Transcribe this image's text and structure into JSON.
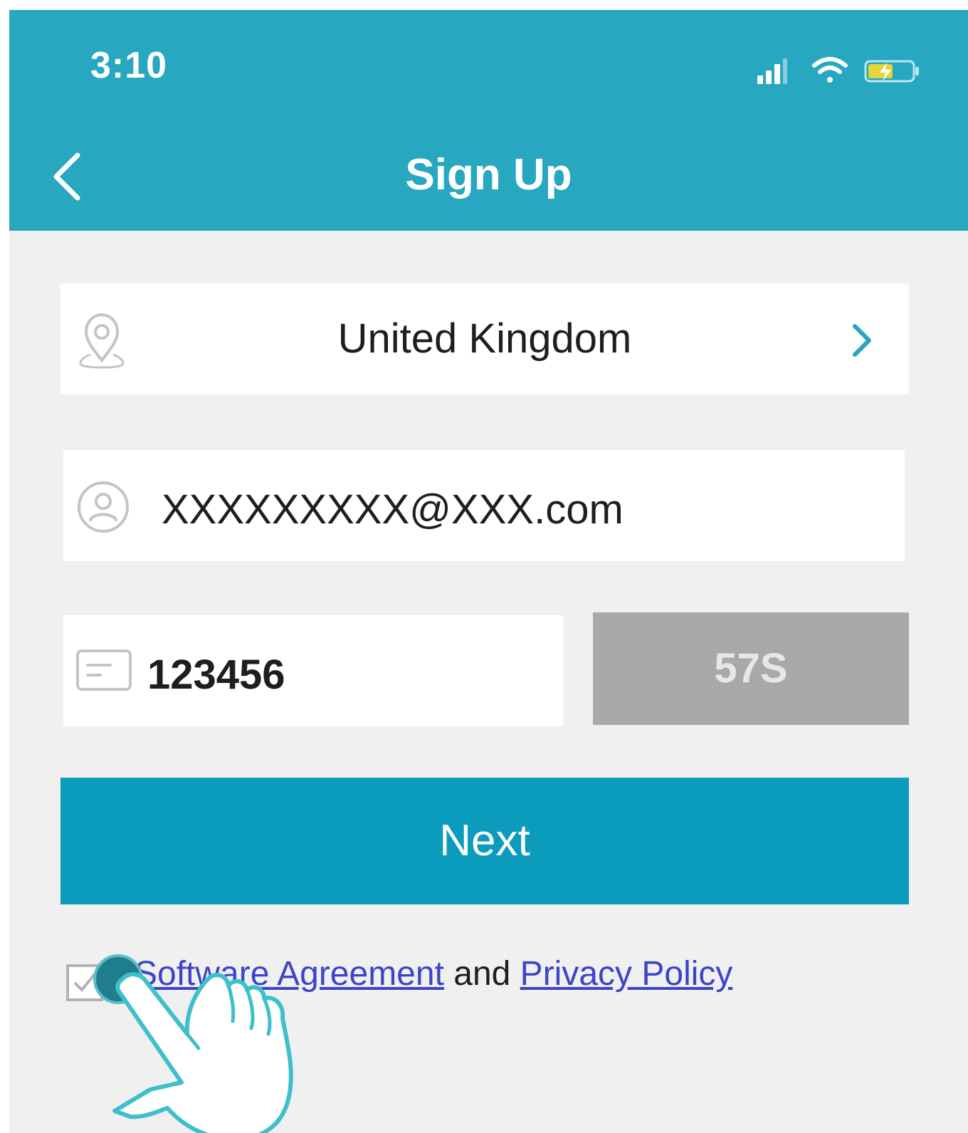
{
  "status_bar": {
    "time": "3:10"
  },
  "header": {
    "title": "Sign Up"
  },
  "form": {
    "region": "United Kingdom",
    "email": "XXXXXXXXX@XXX.com",
    "verification_code": "123456",
    "countdown_label": "57S",
    "next_label": "Next"
  },
  "agreement": {
    "link_1": "Software Agreement",
    "connector": " and ",
    "link_2": "Privacy Policy"
  },
  "colors": {
    "header": "#27a7c0",
    "primary_button": "#0a9bbd",
    "disabled_button": "#a9a9a9",
    "link": "#3c44c8",
    "background": "#f0f0f0"
  }
}
